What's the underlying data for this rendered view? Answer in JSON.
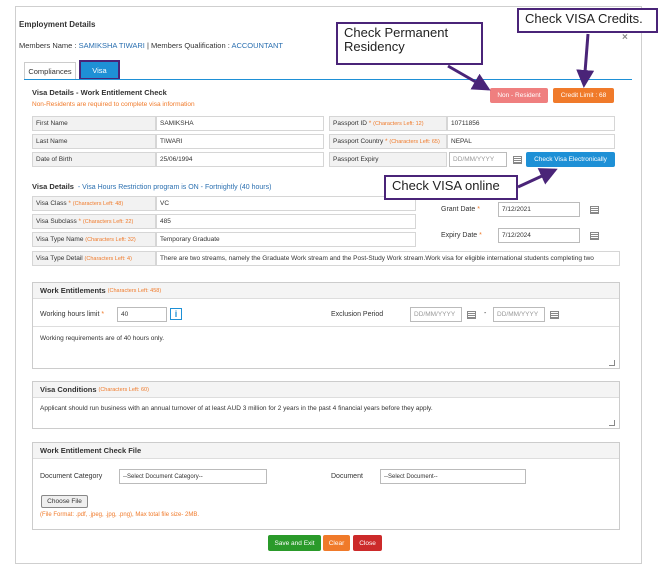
{
  "header": {
    "title": "Employment Details",
    "members_name_label": "Members Name :",
    "members_name": "SAMIKSHA TIWARI",
    "separator": "|",
    "qualification_label": "Members Qualification :",
    "qualification": "ACCOUNTANT",
    "close": "×"
  },
  "tabs": [
    {
      "label": "Compliances"
    },
    {
      "label": "Visa"
    }
  ],
  "visa_check": {
    "title": "Visa Details - Work Entitlement Check",
    "note": "Non-Residents are required to complete visa information",
    "non_resident_btn": "Non - Resident",
    "credit_limit_btn": "Credit Limit : 68",
    "check_visa_btn": "Check Visa Electronically",
    "first_name_label": "First Name",
    "first_name": "SAMIKSHA",
    "last_name_label": "Last Name",
    "last_name": "TIWARI",
    "dob_label": "Date of Birth",
    "dob": "25/06/1994",
    "passport_id_label": "Passport ID",
    "passport_id_hint": "(Characters Left: 12)",
    "passport_id": "10711856",
    "passport_country_label": "Passport Country",
    "passport_country_hint": "(Characters Left: 65)",
    "passport_country": "NEPAL",
    "passport_expiry_label": "Passport Expiry",
    "passport_expiry_ph": "DD/MM/YYYY",
    "required": "*"
  },
  "visa_details": {
    "title": "Visa Details",
    "program_note": "- Visa Hours Restriction program is ON - Fortnightly (40 hours)",
    "visa_class_label": "Visa Class",
    "visa_class_hint": "(Characters Left: 48)",
    "visa_class": "VC",
    "visa_subclass_label": "Visa Subclass",
    "visa_subclass_hint": "(Characters Left: 22)",
    "visa_subclass": "485",
    "visa_type_name_label": "Visa Type Name",
    "visa_type_name_hint": "(Characters Left: 32)",
    "visa_type_name": "Temporary Graduate",
    "visa_type_detail_label": "Visa Type Detail",
    "visa_type_detail_hint": "(Characters Left: 4)",
    "visa_type_detail": "There are two streams, namely the Graduate Work stream and the Post-Study Work stream.Work visa for eligible international students completing two",
    "grant_date_label": "Grant Date",
    "grant_date": "7/12/2021",
    "expiry_date_label": "Expiry Date",
    "expiry_date": "7/12/2024"
  },
  "work_entitlements": {
    "title": "Work Entitlements",
    "hint": "(Characters Left: 458)",
    "hours_label": "Working hours limit",
    "hours_value": "40",
    "info": "i",
    "exclusion_label": "Exclusion Period",
    "date_ph": "DD/MM/YYYY",
    "dash": "-",
    "requirements": "Working requirements are of 40 hours only."
  },
  "visa_conditions": {
    "title": "Visa Conditions",
    "hint": "(Characters Left: 60)",
    "text": "Applicant should run business with an annual turnover of at least AUD 3 million for 2 years in the past 4 financial years before they apply."
  },
  "check_file": {
    "title": "Work Entitlement Check File",
    "doc_category_label": "Document Category",
    "doc_category_value": "--Select Document Category--",
    "doc_label": "Document",
    "doc_value": "--Select Document--",
    "choose_file": "Choose File",
    "format_note": "(File Format: .pdf, .jpeg, .jpg, .png), Max total file size- 2MB."
  },
  "actions": {
    "save": "Save and Exit",
    "clear": "Clear",
    "close": "Close"
  },
  "callouts": {
    "permanent_residency": "Check Permanent Residency",
    "visa_credits": "Check VISA Credits.",
    "visa_online": "Check VISA online"
  },
  "colors": {
    "accent": "#1e90d6",
    "orange": "#f07a2a",
    "salmon": "#ef7f7f",
    "green": "#2a9a2a",
    "red": "#cc2a2a",
    "callout_border": "#4a2478"
  }
}
